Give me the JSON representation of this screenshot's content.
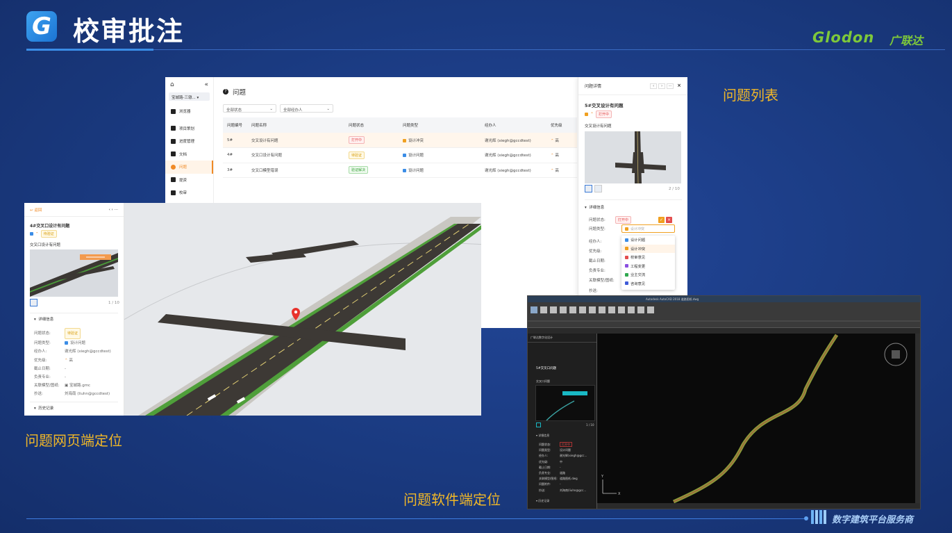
{
  "header": {
    "logo_letter": "G",
    "title": "校审批注",
    "brand_en": "Glodon",
    "brand_cn": "广联达"
  },
  "labels": {
    "issue_list": "问题列表",
    "web_locate": "问题网页端定位",
    "software_locate": "问题软件端定位"
  },
  "footer": {
    "text": "数字建筑平台服务商"
  },
  "web_list": {
    "sidebar": {
      "project": "宝城路-三墩...",
      "items": [
        {
          "label": "浏览器",
          "icon": "browser-icon"
        },
        {
          "label": "项目策划",
          "icon": "flag-icon"
        },
        {
          "label": "进度管理",
          "icon": "schedule-icon"
        },
        {
          "label": "文档",
          "icon": "document-icon"
        },
        {
          "label": "问题",
          "icon": "issue-icon"
        },
        {
          "label": "提资",
          "icon": "submit-icon"
        },
        {
          "label": "校审",
          "icon": "review-icon"
        }
      ]
    },
    "page_title": "问题",
    "filters": {
      "status": "全部状态",
      "assignee": "全部经办人"
    },
    "columns": [
      "问题编号",
      "问题名称",
      "问题状态",
      "问题类型",
      "经办人",
      "优先级"
    ],
    "rows": [
      {
        "id": "5#",
        "name": "交叉设计有问题",
        "status": "打开中",
        "status_color": "red",
        "type": "设计冲突",
        "type_color": "#f0a020",
        "assignee": "谢光辉 (xiegh@gccdtest)",
        "priority": "高"
      },
      {
        "id": "4#",
        "name": "交叉口设计有问题",
        "status": "待验证",
        "status_color": "yellow",
        "type": "设计问题",
        "type_color": "#3b8de6",
        "assignee": "谢光辉 (xiegh@gccdtest)",
        "priority": "高"
      },
      {
        "id": "3#",
        "name": "交叉口模型错误",
        "status": "验证解决",
        "status_color": "green",
        "type": "设计问题",
        "type_color": "#3b8de6",
        "assignee": "谢光辉 (xiegh@gccdtest)",
        "priority": "高"
      }
    ],
    "detail": {
      "header": "问题详情",
      "name": "5#交叉设计有问题",
      "status": "打开中",
      "desc": "交叉设计有问题",
      "page": "2 / 10",
      "section": "详细信息",
      "fields": [
        {
          "label": "问题状态:"
        },
        {
          "label": "问题类型:"
        },
        {
          "label": "经办人:"
        },
        {
          "label": "优先级:"
        },
        {
          "label": "截止日期:"
        },
        {
          "label": "负责专业:"
        },
        {
          "label": "关联模型/图纸:"
        },
        {
          "label": "抄送:"
        }
      ],
      "type_placeholder": "设计冲突",
      "dropdown": [
        {
          "label": "设计问题",
          "color": "#3b8de6"
        },
        {
          "label": "设计冲突",
          "color": "#f0a020"
        },
        {
          "label": "校审意见",
          "color": "#e34d4d"
        },
        {
          "label": "工程变更",
          "color": "#8a4fe0"
        },
        {
          "label": "业主交流",
          "color": "#2fa84f"
        },
        {
          "label": "咨询意见",
          "color": "#3f5bd8"
        }
      ]
    }
  },
  "web_3d": {
    "back": "返回",
    "name": "4#交叉口设计有问题",
    "status": "待验证",
    "desc": "交叉口设计有问题",
    "page": "1 / 10",
    "section": "详细信息",
    "fields": [
      {
        "label": "问题状态:",
        "value": "待验证"
      },
      {
        "label": "问题类型:",
        "value": "设计问题"
      },
      {
        "label": "经办人:",
        "value": "谢光辉 (xiegh@gccdtest)"
      },
      {
        "label": "优先级:",
        "value": "高"
      },
      {
        "label": "截止日期:",
        "value": "-"
      },
      {
        "label": "负责专业:",
        "value": "-"
      },
      {
        "label": "关联模型/图纸:",
        "value": "宝城路.gmc"
      },
      {
        "label": "抄送:",
        "value": "刘海南 (liuhn@gccdtest)"
      }
    ],
    "history": "历史记录"
  },
  "cad": {
    "title": "Autodesk AutoCAD 2018  道路图纸.dwg",
    "panel_title": "广联达数字化设计",
    "issue_name": "5#交叉口问题",
    "desc": "交叉口问题",
    "page": "1 / 10",
    "section": "详细信息",
    "fields": [
      {
        "label": "问题状态:",
        "value": "打开中"
      },
      {
        "label": "问题类型:",
        "value": "设计问题"
      },
      {
        "label": "经办人:",
        "value": "谢光辉(xiegh@gcc..."
      },
      {
        "label": "优先级:",
        "value": "中"
      },
      {
        "label": "截止日期:",
        "value": "-"
      },
      {
        "label": "负责专业:",
        "value": "道路"
      },
      {
        "label": "关联模型/图纸:",
        "value": "道路图纸.dwg"
      },
      {
        "label": "问题附件:",
        "value": "-"
      },
      {
        "label": "抄送:",
        "value": "刘海南(liuhn@gcc..."
      }
    ],
    "history": "历史记录",
    "axis_y": "Y",
    "axis_x": "X"
  }
}
